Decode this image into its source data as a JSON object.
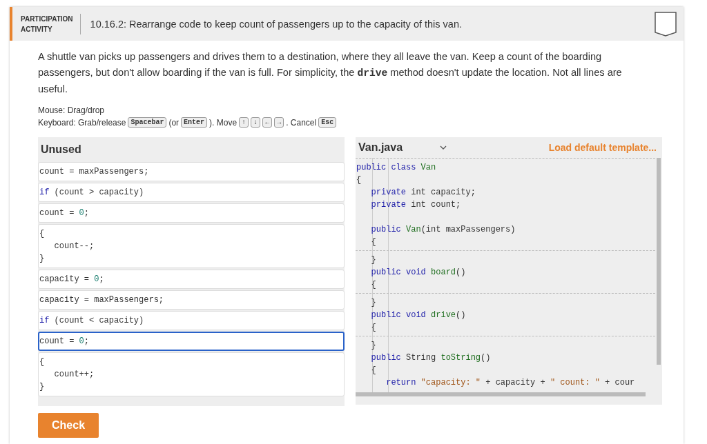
{
  "header": {
    "label_lines": [
      "PARTICIPATION",
      "ACTIVITY"
    ],
    "title": "10.16.2: Rearrange code to keep count of passengers up to the capacity of this van."
  },
  "description": "A shuttle van picks up passengers and drives them to a destination, where they all leave the van. Keep a count of the boarding passengers, but don't allow boarding if the van is full. For simplicity, the **drive** method doesn't update the location. Not all lines are useful.",
  "instructions": {
    "mouse": "Mouse: Drag/drop",
    "keyboard": [
      {
        "kind": "text",
        "text": "Keyboard: Grab/release"
      },
      {
        "kind": "key",
        "text": "Spacebar"
      },
      {
        "kind": "text",
        "text": "(or"
      },
      {
        "kind": "key",
        "text": "Enter"
      },
      {
        "kind": "text",
        "text": "). Move"
      },
      {
        "kind": "key",
        "text": "↑"
      },
      {
        "kind": "key",
        "text": "↓"
      },
      {
        "kind": "key",
        "text": "←"
      },
      {
        "kind": "key",
        "text": "→"
      },
      {
        "kind": "text",
        "text": ". Cancel"
      },
      {
        "kind": "key",
        "text": "Esc"
      }
    ]
  },
  "unused": {
    "title": "Unused",
    "blocks": [
      {
        "selected": false,
        "lines": [
          [
            {
              "text": "count = maxPassengers;",
              "kind": "plain"
            }
          ]
        ]
      },
      {
        "selected": false,
        "lines": [
          [
            {
              "text": "if",
              "kind": "keyword"
            },
            {
              "text": " (count > capacity)",
              "kind": "plain"
            }
          ]
        ]
      },
      {
        "selected": false,
        "lines": [
          [
            {
              "text": "count = ",
              "kind": "plain"
            },
            {
              "text": "0",
              "kind": "number"
            },
            {
              "text": ";",
              "kind": "plain"
            }
          ]
        ]
      },
      {
        "selected": false,
        "lines": [
          [
            {
              "text": "{",
              "kind": "plain"
            }
          ],
          [
            {
              "text": "   count--;",
              "kind": "plain"
            }
          ],
          [
            {
              "text": "}",
              "kind": "plain"
            }
          ]
        ]
      },
      {
        "selected": false,
        "lines": [
          [
            {
              "text": "capacity = ",
              "kind": "plain"
            },
            {
              "text": "0",
              "kind": "number"
            },
            {
              "text": ";",
              "kind": "plain"
            }
          ]
        ]
      },
      {
        "selected": false,
        "lines": [
          [
            {
              "text": "capacity = maxPassengers;",
              "kind": "plain"
            }
          ]
        ]
      },
      {
        "selected": false,
        "lines": [
          [
            {
              "text": "if",
              "kind": "keyword"
            },
            {
              "text": " (count < capacity)",
              "kind": "plain"
            }
          ]
        ]
      },
      {
        "selected": true,
        "lines": [
          [
            {
              "text": "count = ",
              "kind": "plain"
            },
            {
              "text": "0",
              "kind": "number"
            },
            {
              "text": ";",
              "kind": "plain"
            }
          ]
        ]
      },
      {
        "selected": false,
        "lines": [
          [
            {
              "text": "{",
              "kind": "plain"
            }
          ],
          [
            {
              "text": "   count++;",
              "kind": "plain"
            }
          ],
          [
            {
              "text": "}",
              "kind": "plain"
            }
          ]
        ]
      }
    ]
  },
  "editor": {
    "file": "Van.java",
    "load_link": "Load default template...",
    "segments": [
      [
        {
          "tokens": [
            {
              "text": "public class",
              "kind": "keyword"
            },
            {
              "text": " Van",
              "kind": "name"
            }
          ]
        },
        {
          "tokens": [
            {
              "text": "{",
              "kind": "plain"
            }
          ]
        },
        {
          "tokens": [
            {
              "text": "   private",
              "kind": "keyword"
            },
            {
              "text": " int capacity;",
              "kind": "plain"
            }
          ]
        },
        {
          "tokens": [
            {
              "text": "   private",
              "kind": "keyword"
            },
            {
              "text": " int count;",
              "kind": "plain"
            }
          ]
        },
        {
          "blank_before": true,
          "tokens": [
            {
              "text": "   public",
              "kind": "keyword"
            },
            {
              "text": " Van",
              "kind": "name"
            },
            {
              "text": "(int maxPassengers)",
              "kind": "plain"
            }
          ]
        },
        {
          "tokens": [
            {
              "text": "   {",
              "kind": "plain"
            }
          ]
        }
      ],
      [
        {
          "tokens": [
            {
              "text": "   }",
              "kind": "plain"
            }
          ]
        },
        {
          "tokens": [
            {
              "text": "   public void",
              "kind": "keyword"
            },
            {
              "text": " board",
              "kind": "name"
            },
            {
              "text": "()",
              "kind": "plain"
            }
          ]
        },
        {
          "tokens": [
            {
              "text": "   {",
              "kind": "plain"
            }
          ]
        }
      ],
      [
        {
          "tokens": [
            {
              "text": "   }",
              "kind": "plain"
            }
          ]
        },
        {
          "tokens": [
            {
              "text": "   public void",
              "kind": "keyword"
            },
            {
              "text": " drive",
              "kind": "name"
            },
            {
              "text": "()",
              "kind": "plain"
            }
          ]
        },
        {
          "tokens": [
            {
              "text": "   {",
              "kind": "plain"
            }
          ]
        }
      ],
      [
        {
          "tokens": [
            {
              "text": "   }",
              "kind": "plain"
            }
          ]
        },
        {
          "tokens": [
            {
              "text": "   public",
              "kind": "keyword"
            },
            {
              "text": " String",
              "kind": "plain"
            },
            {
              "text": " toString",
              "kind": "name"
            },
            {
              "text": "()",
              "kind": "plain"
            }
          ]
        },
        {
          "tokens": [
            {
              "text": "   {",
              "kind": "plain"
            }
          ]
        },
        {
          "tokens": [
            {
              "text": "      return",
              "kind": "keyword"
            },
            {
              "text": " \"capacity: \"",
              "kind": "string"
            },
            {
              "text": " + capacity + ",
              "kind": "plain"
            },
            {
              "text": "\" count: \"",
              "kind": "string"
            },
            {
              "text": " + cour",
              "kind": "plain"
            }
          ]
        }
      ]
    ]
  },
  "check_button": "Check"
}
